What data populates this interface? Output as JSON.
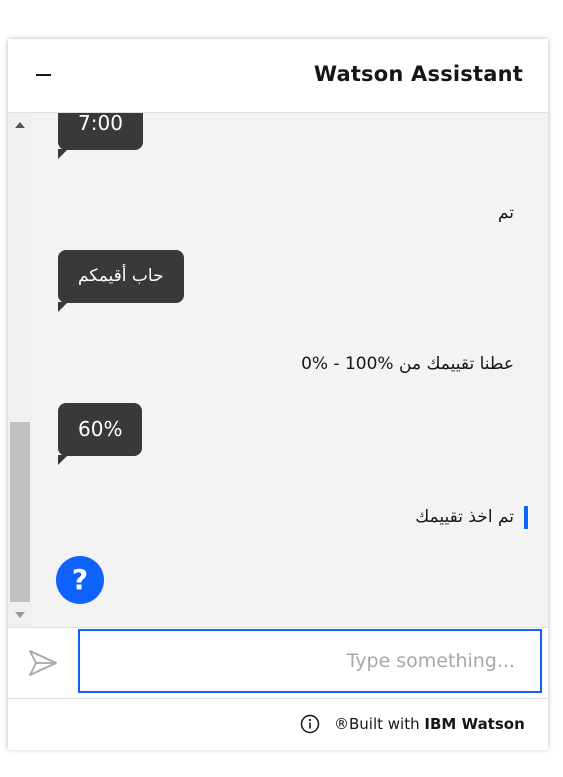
{
  "header": {
    "title": "Watson Assistant",
    "minimize_icon": "minimize-icon"
  },
  "messages": [
    {
      "from": "bot",
      "text": "7:00"
    },
    {
      "from": "user",
      "text": "تم"
    },
    {
      "from": "bot",
      "text": "حاب أقيمكم"
    },
    {
      "from": "user",
      "text": "0% - 100% عطنا تقييمك من"
    },
    {
      "from": "bot",
      "text": "60%"
    },
    {
      "from": "user",
      "text": "تم اخذ تقييمك"
    }
  ],
  "help_button": {
    "label": "?"
  },
  "input": {
    "placeholder": "Type something...",
    "value": ""
  },
  "footer": {
    "built_with": "Built with",
    "brand": "IBM Watson",
    "registered": "®"
  },
  "colors": {
    "accent": "#0f62fe",
    "bot_bubble": "#393939",
    "chat_bg": "#f3f3f3"
  }
}
